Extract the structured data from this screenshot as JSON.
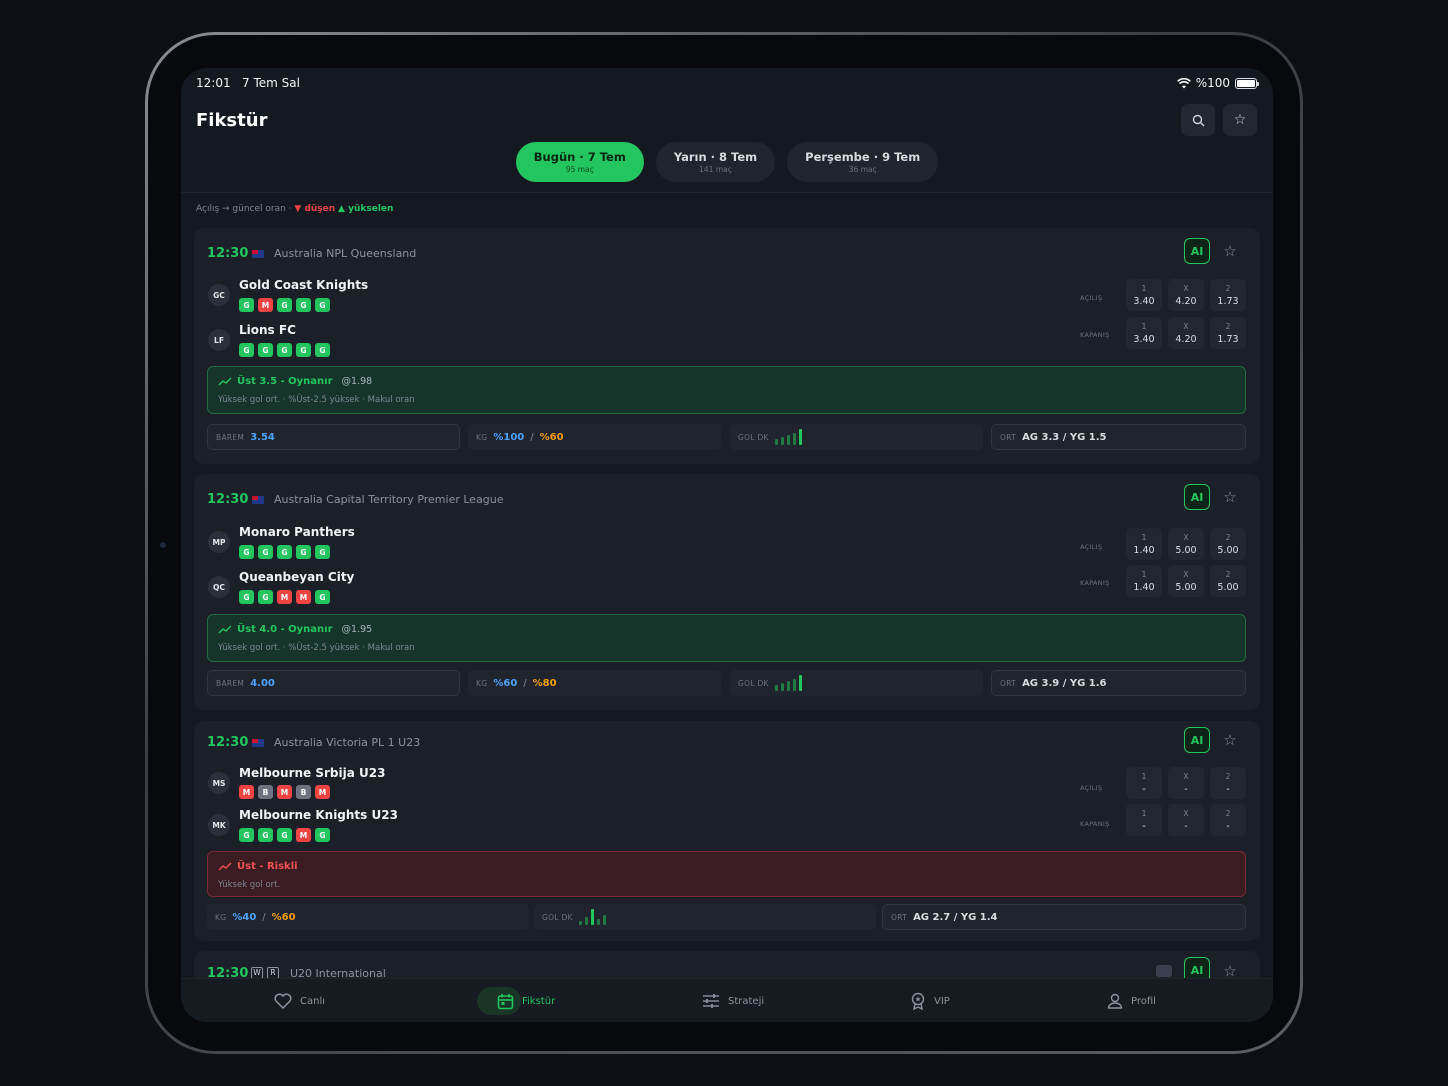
{
  "status": {
    "time": "12:01",
    "date": "7 Tem Sal",
    "battery": "%100"
  },
  "header": {
    "title": "Fikstür"
  },
  "tabs": [
    {
      "label": "Bugün · 7 Tem",
      "count": "95 maç",
      "active": true
    },
    {
      "label": "Yarın · 8 Tem",
      "count": "141 maç",
      "active": false
    },
    {
      "label": "Perşembe · 9 Tem",
      "count": "36 maç",
      "active": false
    }
  ],
  "legend": {
    "text": "Açılış → güncel oran ·",
    "down": "▼ düşen",
    "up": "▲ yükselen"
  },
  "labels": {
    "open": "AÇILIŞ",
    "close": "KAPANIŞ",
    "barem": "BAREM",
    "kg": "KG",
    "goldk": "GOL DK",
    "ort": "ORT",
    "ai": "AI",
    "k1": "1",
    "kx": "X",
    "k2": "2"
  },
  "matches": [
    {
      "time": "12:30",
      "league": "Australia NPL Queensland",
      "home": {
        "abbr": "GC",
        "name": "Gold Coast Knights",
        "form": [
          "G",
          "M",
          "G",
          "G",
          "G"
        ]
      },
      "away": {
        "abbr": "LF",
        "name": "Lions FC",
        "form": [
          "G",
          "G",
          "G",
          "G",
          "G"
        ]
      },
      "open": {
        "one": "3.40",
        "x": "4.20",
        "two": "1.73"
      },
      "close": {
        "one": "3.40",
        "x": "4.20",
        "two": "1.73"
      },
      "tip": {
        "title": "Üst 3.5 - Oynanır",
        "odd": "@1.98",
        "desc": "Yüksek gol ort. · %Üst-2.5 yüksek · Makul oran",
        "tone": "green"
      },
      "barem": "3.54",
      "kg1": "%100",
      "kg2": "%60",
      "ort": "AG 3.3 / YG 1.5",
      "goldk": [
        3,
        4,
        5,
        6,
        8
      ]
    },
    {
      "time": "12:30",
      "league": "Australia Capital Territory Premier League",
      "home": {
        "abbr": "MP",
        "name": "Monaro Panthers",
        "form": [
          "G",
          "G",
          "G",
          "G",
          "G"
        ]
      },
      "away": {
        "abbr": "QC",
        "name": "Queanbeyan City",
        "form": [
          "G",
          "G",
          "M",
          "M",
          "G"
        ]
      },
      "open": {
        "one": "1.40",
        "x": "5.00",
        "two": "5.00"
      },
      "close": {
        "one": "1.40",
        "x": "5.00",
        "two": "5.00"
      },
      "tip": {
        "title": "Üst 4.0 - Oynanır",
        "odd": "@1.95",
        "desc": "Yüksek gol ort. · %Üst-2.5 yüksek · Makul oran",
        "tone": "green"
      },
      "barem": "4.00",
      "kg1": "%60",
      "kg2": "%80",
      "ort": "AG 3.9 / YG 1.6",
      "goldk": [
        3,
        4,
        5,
        6,
        8
      ]
    },
    {
      "time": "12:30",
      "league": "Australia Victoria PL 1 U23",
      "home": {
        "abbr": "MS",
        "name": "Melbourne Srbija U23",
        "form": [
          "M",
          "B",
          "M",
          "B",
          "M"
        ]
      },
      "away": {
        "abbr": "MK",
        "name": "Melbourne Knights U23",
        "form": [
          "G",
          "G",
          "G",
          "M",
          "G"
        ]
      },
      "open": {
        "one": "-",
        "x": "-",
        "two": "-"
      },
      "close": {
        "one": "-",
        "x": "-",
        "two": "-"
      },
      "tip": {
        "title": "Üst - Riskli",
        "odd": "",
        "desc": "Yüksek gol ort.",
        "tone": "red"
      },
      "kg1": "%40",
      "kg2": "%60",
      "ort": "AG 2.7 / YG 1.4",
      "goldk": [
        2,
        4,
        8,
        3,
        5
      ]
    },
    {
      "time": "12:30",
      "league": "U20 International",
      "tag1": "W",
      "tag2": "R"
    }
  ],
  "nav": [
    {
      "label": "Canlı",
      "icon": "heart-icon"
    },
    {
      "label": "Fikstür",
      "icon": "calendar-icon",
      "active": true
    },
    {
      "label": "Strateji",
      "icon": "sliders-icon"
    },
    {
      "label": "VIP",
      "icon": "award-icon"
    },
    {
      "label": "Profil",
      "icon": "user-icon"
    }
  ],
  "colors": {
    "accent": "#22c55e",
    "loss": "#ef4444",
    "draw": "#6b7280",
    "kg_first": "#4da3ff",
    "kg_second": "#f59e0b"
  }
}
